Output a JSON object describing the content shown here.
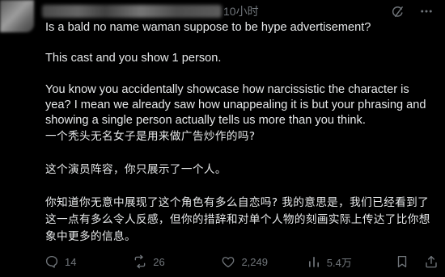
{
  "post": {
    "time_ago": "10小时",
    "body": {
      "en": [
        "Is a bald no name waman suppose to be hype advertisement?",
        "This cast and you show 1 person.",
        "You know you accidentally showcase how narcissistic the character is yea? I mean we already saw how unappealing it is but your phrasing and showing a single person actually tells us more than you think."
      ],
      "zh": [
        "一个秃头无名女子是用来做广告炒作的吗?",
        "这个演员阵容，你只展示了一个人。",
        "你知道你无意中展现了这个角色有多么自恋吗? 我的意思是，我们已经看到了这一点有多么令人反感，但你的措辞和对单个人物的刻画实际上传达了比你想象中更多的信息。"
      ]
    },
    "stats": {
      "replies": "14",
      "reposts": "26",
      "likes": "2,249",
      "views": "5.4万"
    },
    "icons": {
      "header": [
        "grok-icon",
        "more-icon"
      ],
      "actions": [
        "reply-icon",
        "repost-icon",
        "like-icon",
        "views-icon",
        "bookmark-icon",
        "share-icon"
      ]
    }
  }
}
